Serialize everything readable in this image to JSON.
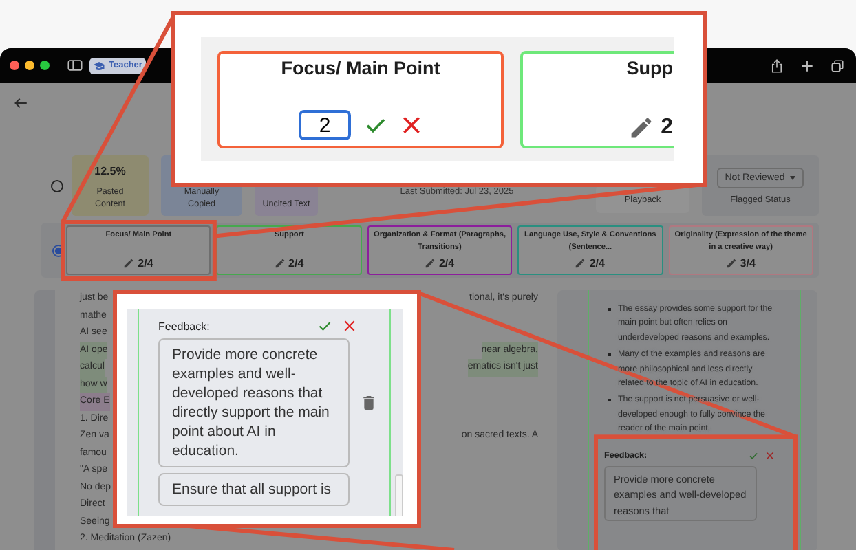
{
  "browser": {
    "tab_label": "Teacher"
  },
  "stats_row": {
    "selected": false,
    "boxes": [
      {
        "value": "12.5%",
        "label": "Pasted Content",
        "color": "#8e8b70"
      },
      {
        "label": "Manually Copied",
        "color": "#7b8597"
      },
      {
        "label": "Uncited Text",
        "color": "#8a8394"
      }
    ],
    "last_submitted": "Last Submitted: Jul 23, 2025",
    "playback": "Playback",
    "flag": {
      "value": "Not Reviewed",
      "label": "Flagged Status"
    }
  },
  "rubric_row": {
    "selected": true,
    "criteria": [
      {
        "title": "Focus/ Main Point",
        "score": "2/4",
        "color": "#6e6e6e"
      },
      {
        "title": "Support",
        "score": "2/4",
        "color": "#46a84e"
      },
      {
        "title": "Organization & Format (Paragraphs, Transitions)",
        "score": "2/4",
        "color": "#8c1e9c"
      },
      {
        "title": "Language Use, Style & Conventions (Sentence...",
        "score": "2/4",
        "color": "#2a8f80"
      },
      {
        "title": "Originality (Expression of the theme in a creative way)",
        "score": "3/4",
        "color": "#b07880"
      }
    ]
  },
  "essay_lines": [
    {
      "start": "just be",
      "end": "tional, it's purely"
    },
    {
      "start": "mathe"
    },
    {
      "start": "AI see"
    },
    {
      "start": "AI ope",
      "end": "near algebra,",
      "color": "#7e8c7b"
    },
    {
      "start": "calcul",
      "end": "ematics isn't just",
      "color": "#7e8c7b"
    },
    {
      "start": "how w",
      "color": "#7e8c7b"
    },
    {
      "start": "Core E",
      "color": "#8c7d8c"
    },
    {
      "start": "1. Dire"
    },
    {
      "start": "Zen va",
      "end": "on sacred texts. A"
    },
    {
      "start": "famou"
    },
    {
      "start": "\"A spe"
    },
    {
      "start": "No dep"
    },
    {
      "start": "Direct"
    },
    {
      "start": "Seeing"
    },
    {
      "start": "2. Meditation (Zazen)"
    }
  ],
  "comments": {
    "bullets": [
      "The essay provides some support for the main point but often relies on underdeveloped reasons and examples.",
      "Many of the examples and reasons are more philosophical and less directly related to the topic of AI in education.",
      "The support is not persuasive or well-developed enough to fully convince the reader of the main point."
    ],
    "feedback_label": "Feedback:",
    "feedback_text": "Provide more concrete examples and well-developed reasons that"
  },
  "zoom_scores": {
    "cards": [
      {
        "kind": "editing",
        "title": "Focus/ Main Point",
        "value": "2",
        "color": "#f4623a"
      },
      {
        "kind": "display",
        "title": "Supp",
        "score": "2",
        "color": "#6ee87a"
      }
    ]
  },
  "zoom_feedback": {
    "label": "Feedback:",
    "texts": [
      "Provide more concrete examples and well-developed reasons that directly support the main point about AI in education.",
      "Ensure that all support is"
    ]
  }
}
